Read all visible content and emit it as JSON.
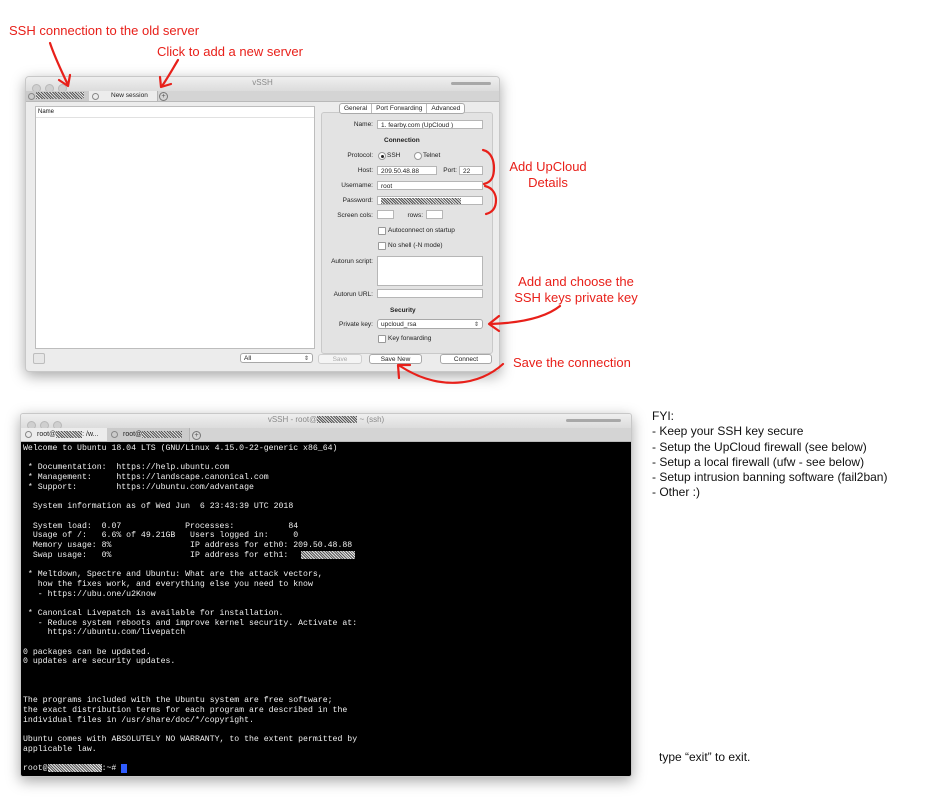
{
  "annotations": {
    "ssh_old_server": "SSH connection to the old server",
    "add_new_server": "Click to add a new server",
    "add_upcloud_line1": "Add UpCloud",
    "add_upcloud_line2": "Details",
    "add_key_line1": "Add and choose the",
    "add_key_line2": "SSH keys private key",
    "save_connection": "Save the connection",
    "color": "#e8201a"
  },
  "vssh": {
    "title": "vSSH",
    "tabs": {
      "new_session": "New session"
    },
    "list": {
      "header": "Name"
    },
    "segments": [
      "General",
      "Port Forwarding",
      "Advanced"
    ],
    "form": {
      "name_label": "Name:",
      "name_value": "1. fearby.com  (UpCloud )",
      "connection_header": "Connection",
      "protocol_label": "Protocol:",
      "protocol_ssh": "SSH",
      "protocol_telnet": "Telnet",
      "host_label": "Host:",
      "host_value": "209.50.48.88",
      "port_label": "Port:",
      "port_value": "22",
      "username_label": "Username:",
      "username_value": "root",
      "password_label": "Password:",
      "screen_cols_label": "Screen cols:",
      "rows_label": "rows:",
      "autoconnect_label": "Autoconnect on startup",
      "noshell_label": "No shell (-N mode)",
      "autorun_script_label": "Autorun script:",
      "autorun_url_label": "Autorun URL:",
      "security_header": "Security",
      "private_key_label": "Private key:",
      "private_key_value": "upcloud_rsa",
      "key_forwarding_label": "Key forwarding"
    },
    "bottom": {
      "filter_value": "All",
      "save": "Save",
      "save_new": "Save New",
      "connect": "Connect"
    }
  },
  "terminal": {
    "title_prefix": "vSSH - root@",
    "title_suffix": " ~ (ssh)",
    "tab1_prefix": "root@",
    "tab1_suffix": ": /w...",
    "tab2_prefix": "root@",
    "lines": [
      "Welcome to Ubuntu 18.04 LTS (GNU/Linux 4.15.0-22-generic x86_64)",
      "",
      " * Documentation:  https://help.ubuntu.com",
      " * Management:     https://landscape.canonical.com",
      " * Support:        https://ubuntu.com/advantage",
      "",
      "  System information as of Wed Jun  6 23:43:39 UTC 2018",
      "",
      "  System load:  0.07             Processes:           84",
      "  Usage of /:   6.6% of 49.21GB   Users logged in:     0",
      "  Memory usage: 8%                IP address for eth0: 209.50.48.88",
      "  Swap usage:   0%                IP address for eth1:",
      "",
      " * Meltdown, Spectre and Ubuntu: What are the attack vectors,",
      "   how the fixes work, and everything else you need to know",
      "   - https://ubu.one/u2Know",
      "",
      " * Canonical Livepatch is available for installation.",
      "   - Reduce system reboots and improve kernel security. Activate at:",
      "     https://ubuntu.com/livepatch",
      "",
      "0 packages can be updated.",
      "0 updates are security updates.",
      "",
      "",
      "",
      "The programs included with the Ubuntu system are free software;",
      "the exact distribution terms for each program are described in the",
      "individual files in /usr/share/doc/*/copyright.",
      "",
      "Ubuntu comes with ABSOLUTELY NO WARRANTY, to the extent permitted by",
      "applicable law."
    ],
    "prompt_prefix": "root@",
    "prompt_suffix": ":~# ",
    "cursor_color": "#2f5cff"
  },
  "fyi": {
    "title": "FYI:",
    "items": [
      "- Keep your SSH key secure",
      "- Setup the UpCloud firewall (see below)",
      "- Setup a local firewall (ufw - see below)",
      "- Setup intrusion banning software (fail2ban)",
      "- Other :)"
    ]
  },
  "exit_note": "type “exit” to exit."
}
